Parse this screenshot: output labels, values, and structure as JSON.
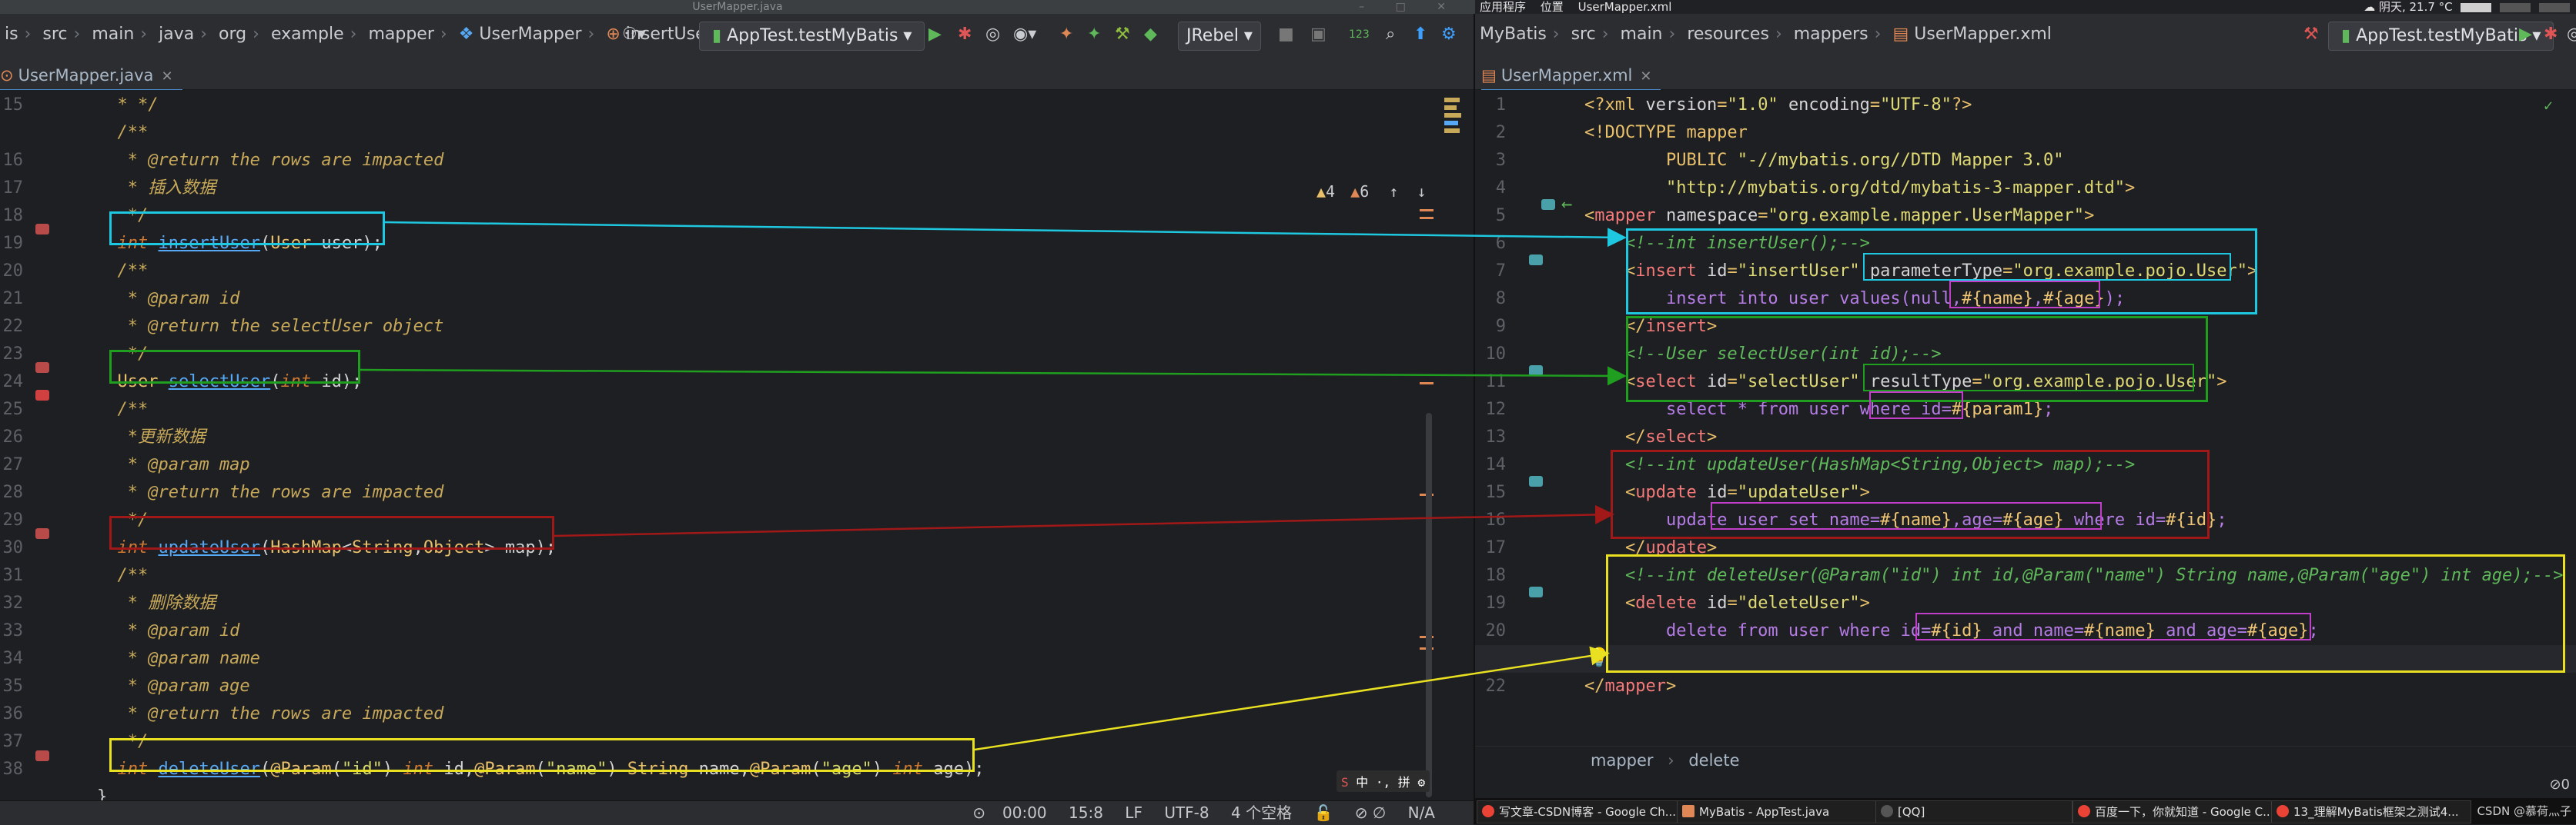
{
  "os_left": {
    "title": "UserMapper.java"
  },
  "os_right": {
    "menu": [
      "应用程序",
      "位置",
      "UserMapper.xml"
    ],
    "weather": "阴天, 21.7 °C"
  },
  "left_toolbar": {
    "breadcrumb": [
      "is",
      "src",
      "main",
      "java",
      "org",
      "example",
      "mapper",
      "UserMapper",
      "insertUser"
    ],
    "run_config": "AppTest.testMyBatis",
    "jrebel": "JRebel",
    "counter": "123"
  },
  "right_toolbar": {
    "breadcrumb": [
      "MyBatis",
      "src",
      "main",
      "resources",
      "mappers",
      "UserMapper.xml"
    ],
    "run_config": "AppTest.testMyBatis"
  },
  "left_tab": {
    "label": "UserMapper.java"
  },
  "right_tab": {
    "label": "UserMapper.xml"
  },
  "inspection": {
    "warnings": "4",
    "weak_warnings": "6"
  },
  "java_lines": [
    {
      "n": "15",
      "text": "  * */"
    },
    {
      "n": "",
      "text": "  /**"
    },
    {
      "n": "16",
      "text": "   * @return the rows are impacted"
    },
    {
      "n": "17",
      "text": "   * 插入数据"
    },
    {
      "n": "18",
      "text": "   */"
    },
    {
      "n": "19",
      "text": "  int insertUser(User user);"
    },
    {
      "n": "20",
      "text": "  /**"
    },
    {
      "n": "21",
      "text": "   * @param id"
    },
    {
      "n": "22",
      "text": "   * @return the selectUser object"
    },
    {
      "n": "23",
      "text": "   */"
    },
    {
      "n": "24",
      "text": "  User selectUser(int id);"
    },
    {
      "n": "25",
      "text": "  /**"
    },
    {
      "n": "26",
      "text": "   *更新数据"
    },
    {
      "n": "27",
      "text": "   * @param map"
    },
    {
      "n": "28",
      "text": "   * @return the rows are impacted"
    },
    {
      "n": "29",
      "text": "   */"
    },
    {
      "n": "30",
      "text": "  int updateUser(HashMap<String,Object> map);"
    },
    {
      "n": "31",
      "text": "  /**"
    },
    {
      "n": "32",
      "text": "   * 删除数据"
    },
    {
      "n": "33",
      "text": "   * @param id"
    },
    {
      "n": "34",
      "text": "   * @param name"
    },
    {
      "n": "35",
      "text": "   * @param age"
    },
    {
      "n": "36",
      "text": "   * @return the rows are impacted"
    },
    {
      "n": "37",
      "text": "   */"
    },
    {
      "n": "38",
      "text": "  int deleteUser(@Param(\"id\") int id,@Param(\"name\") String name,@Param(\"age\") int age);"
    },
    {
      "n": "",
      "text": "}"
    }
  ],
  "xml_lines": [
    {
      "n": "1",
      "text": "<?xml version=\"1.0\" encoding=\"UTF-8\"?>"
    },
    {
      "n": "2",
      "text": "<!DOCTYPE mapper"
    },
    {
      "n": "3",
      "text": "        PUBLIC \"-//mybatis.org//DTD Mapper 3.0\""
    },
    {
      "n": "4",
      "text": "        \"http://mybatis.org/dtd/mybatis-3-mapper.dtd\">"
    },
    {
      "n": "5",
      "text": "<mapper namespace=\"org.example.mapper.UserMapper\">"
    },
    {
      "n": "6",
      "text": "    <!--int insertUser();-->"
    },
    {
      "n": "7",
      "text": "    <insert id=\"insertUser\" parameterType=\"org.example.pojo.User\">"
    },
    {
      "n": "8",
      "text": "        insert into user values(null,#{name},#{age});"
    },
    {
      "n": "9",
      "text": "    </insert>"
    },
    {
      "n": "10",
      "text": "    <!--User selectUser(int id);-->"
    },
    {
      "n": "11",
      "text": "    <select id=\"selectUser\" resultType=\"org.example.pojo.User\">"
    },
    {
      "n": "12",
      "text": "        select * from user where id=#{param1};"
    },
    {
      "n": "13",
      "text": "    </select>"
    },
    {
      "n": "14",
      "text": "    <!--int updateUser(HashMap<String,Object> map);-->"
    },
    {
      "n": "15",
      "text": "    <update id=\"updateUser\">"
    },
    {
      "n": "16",
      "text": "        update user set name=#{name},age=#{age} where id=#{id};"
    },
    {
      "n": "17",
      "text": "    </update>"
    },
    {
      "n": "18",
      "text": "    <!--int deleteUser(@Param(\"id\") int id,@Param(\"name\") String name,@Param(\"age\") int age);-->"
    },
    {
      "n": "19",
      "text": "    <delete id=\"deleteUser\">"
    },
    {
      "n": "20",
      "text": "        delete from user where id=#{id} and name=#{name} and age=#{age};"
    },
    {
      "n": "21",
      "text": "    </delete>"
    },
    {
      "n": "22",
      "text": "</mapper>"
    }
  ],
  "xml_breadcrumb": [
    "mapper",
    "delete"
  ],
  "status_left": {
    "time": "00:00",
    "position": "15:8",
    "line_sep": "LF",
    "encoding": "UTF-8",
    "indent": "4 个空格",
    "na": "N/A"
  },
  "taskbar": [
    {
      "label": "写文章-CSDN博客 - Google Ch...",
      "color": "#ea4335"
    },
    {
      "label": "MyBatis - AppTest.java",
      "color": "#e08855"
    },
    {
      "label": "[QQ]",
      "color": "#555555"
    },
    {
      "label": "百度一下，你就知道 - Google C...",
      "color": "#ea4335"
    },
    {
      "label": "13_理解MyBatis框架之测试4...",
      "color": "#ea4335"
    }
  ],
  "watermark": "CSDN @慕荷灬子",
  "colors": {
    "insert": "#1ec8e0",
    "select": "#1f9e1f",
    "update": "#a01818",
    "delete": "#e8e020",
    "param": "#c13ec8"
  }
}
